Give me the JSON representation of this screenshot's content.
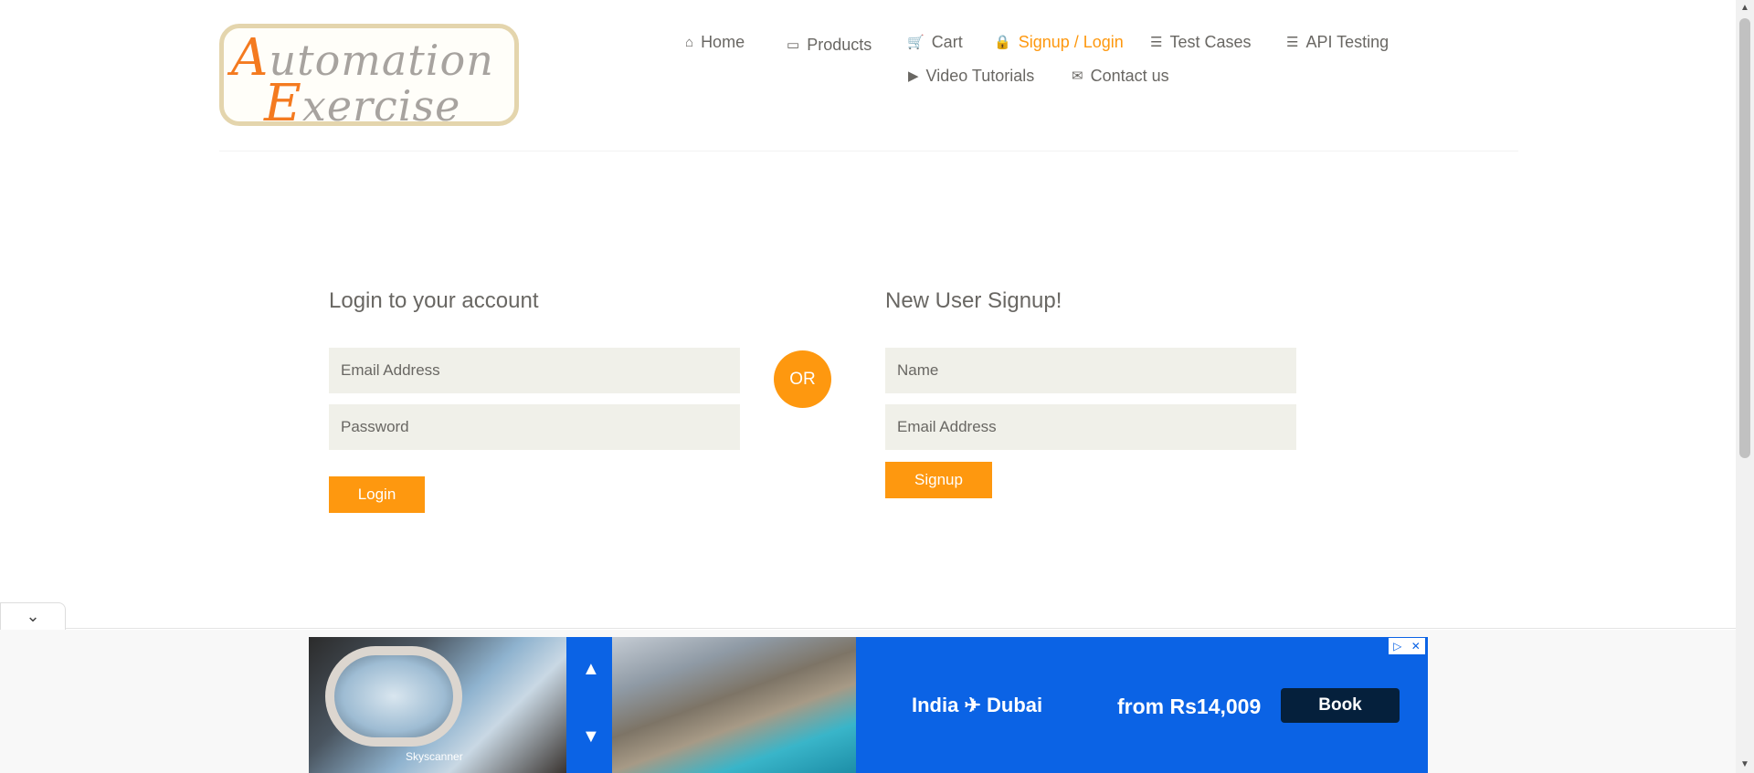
{
  "header": {
    "logo": {
      "line1_cap": "A",
      "line1_rest": "utomation",
      "line2_cap": "E",
      "line2_rest": "xercise"
    },
    "nav": [
      {
        "label": "Home",
        "icon": "home-icon",
        "glyph": "⌂"
      },
      {
        "label": "Products",
        "icon": "briefcase-icon",
        "glyph": "▭"
      },
      {
        "label": "Cart",
        "icon": "cart-icon",
        "glyph": "🛒"
      },
      {
        "label": "Signup / Login",
        "icon": "lock-icon",
        "glyph": "🔒",
        "active": true
      },
      {
        "label": "Test Cases",
        "icon": "list-icon",
        "glyph": "☰"
      },
      {
        "label": "API Testing",
        "icon": "list-icon",
        "glyph": "☰"
      },
      {
        "label": "Video Tutorials",
        "icon": "youtube-icon",
        "glyph": "▶"
      },
      {
        "label": "Contact us",
        "icon": "envelope-icon",
        "glyph": "✉"
      }
    ]
  },
  "login": {
    "title": "Login to your account",
    "email_placeholder": "Email Address",
    "password_placeholder": "Password",
    "button": "Login"
  },
  "divider_label": "OR",
  "signup": {
    "title": "New User Signup!",
    "name_placeholder": "Name",
    "email_placeholder": "Email Address",
    "button": "Signup"
  },
  "ad": {
    "brand": "Skyscanner",
    "route": "India ✈ Dubai",
    "price": "from Rs14,009",
    "cta": "Book",
    "up_arrow": "▲",
    "down_arrow": "▼",
    "info_icon": "▷",
    "close_icon": "✕"
  },
  "colors": {
    "accent": "#fe980f",
    "text": "#696763",
    "field_bg": "#f0f0e9",
    "ad_blue": "#0b63e5"
  }
}
